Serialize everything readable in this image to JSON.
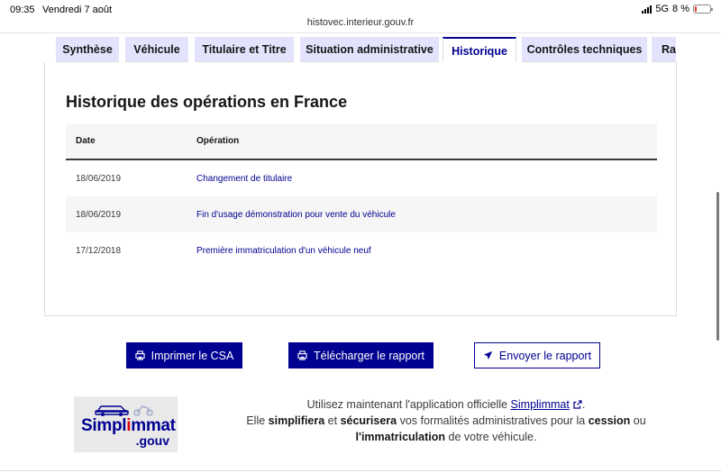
{
  "status_bar": {
    "time": "09:35",
    "date": "Vendredi 7 août",
    "network": "5G",
    "battery": "8 %",
    "battery_color": "#e0362c"
  },
  "browser": {
    "url": "histovec.interieur.gouv.fr"
  },
  "tabs": [
    {
      "label": "Synthèse",
      "active": false
    },
    {
      "label": "Véhicule",
      "active": false
    },
    {
      "label": "Titulaire et Titre",
      "active": false
    },
    {
      "label": "Situation administrative",
      "active": false
    },
    {
      "label": "Historique",
      "active": true
    },
    {
      "label": "Contrôles techniques",
      "active": false
    },
    {
      "label": "Ra",
      "active": false
    }
  ],
  "history": {
    "title": "Historique des opérations en France",
    "columns": {
      "date": "Date",
      "operation": "Opération"
    },
    "rows": [
      {
        "date": "18/06/2019",
        "operation": "Changement de titulaire"
      },
      {
        "date": "18/06/2019",
        "operation": "Fin d'usage démonstration pour vente du véhicule"
      },
      {
        "date": "17/12/2018",
        "operation": "Première immatriculation d'un véhicule neuf"
      }
    ]
  },
  "actions": {
    "print_label": "Imprimer le CSA",
    "print_icon": "printer-icon",
    "download_label": "Télécharger le rapport",
    "download_icon": "printer-icon",
    "send_label": "Envoyer le rapport",
    "send_icon": "send-arrow-icon"
  },
  "promo": {
    "logo_word_a": "Simpl",
    "logo_word_b": "i",
    "logo_word_c": "mmat",
    "logo_gouv": ".gouv",
    "line1_prefix": "Utilisez maintenant l'application officielle ",
    "line1_link": "Simplimmat",
    "line1_suffix": ".",
    "line2_a": "Elle ",
    "line2_b": "simplifiera",
    "line2_c": " et ",
    "line2_d": "sécurisera",
    "line2_e": " vos formalités administratives pour la ",
    "line2_f": "cession",
    "line2_g": " ou",
    "line3_a": "l'immatriculation",
    "line3_b": " de votre véhicule."
  },
  "colors": {
    "brand_blue": "#000091",
    "tab_inactive_bg": "#e3e3fd",
    "row_alt_bg": "#f6f6f6",
    "marianne_red": "#e1000f"
  }
}
